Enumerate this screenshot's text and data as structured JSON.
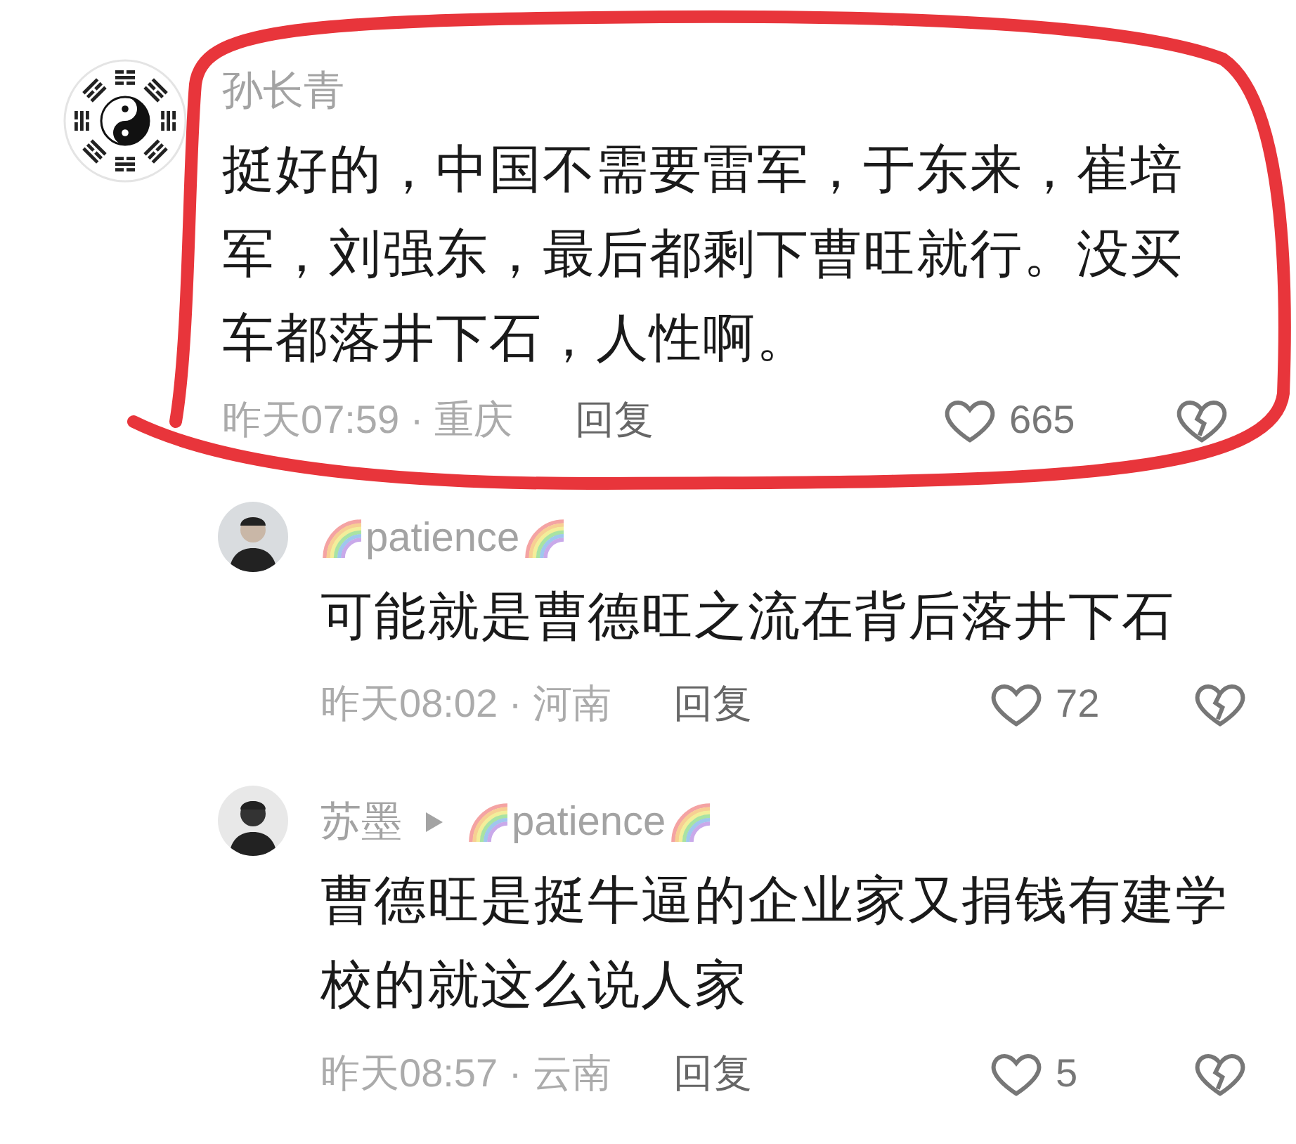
{
  "comments": [
    {
      "author": "孙长青",
      "text": "挺好的，中国不需要雷军，于东来，崔培军，刘强东，最后都剩下曹旺就行。没买车都落井下石，人性啊。",
      "meta": "昨天07:59 · 重庆",
      "reply_label": "回复",
      "likes": "665",
      "replies": [
        {
          "author": "patience",
          "rainbow": true,
          "text": "可能就是曹德旺之流在背后落井下石",
          "meta": "昨天08:02 · 河南",
          "reply_label": "回复",
          "likes": "72"
        },
        {
          "author": "苏墨",
          "reply_to": {
            "author": "patience",
            "rainbow": true
          },
          "text": "曹德旺是挺牛逼的企业家又捐钱有建学校的就这么说人家",
          "meta": "昨天08:57 · 云南",
          "reply_label": "回复",
          "likes": "5"
        }
      ]
    }
  ],
  "annotation": {
    "kind": "circle"
  }
}
